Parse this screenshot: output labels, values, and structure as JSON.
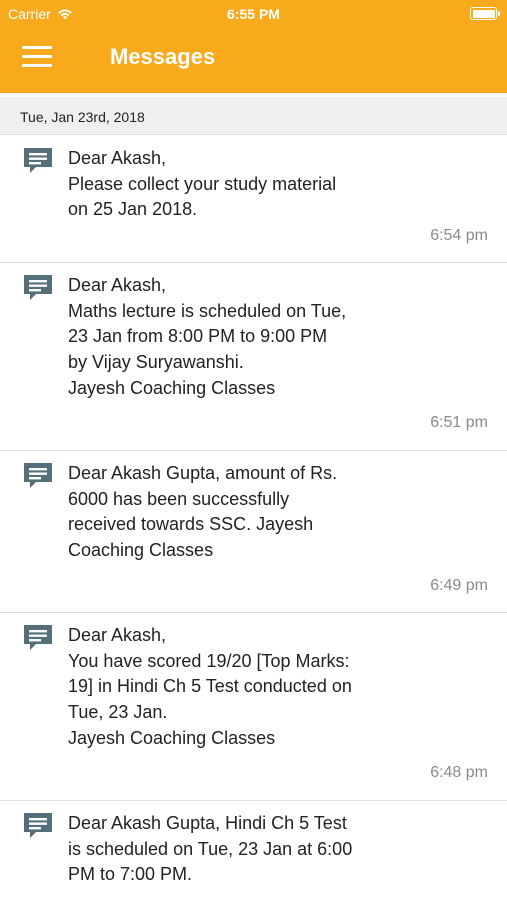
{
  "status_bar": {
    "carrier": "Carrier",
    "time": "6:55 PM",
    "battery_level": 1.0
  },
  "header": {
    "title": "Messages"
  },
  "date_section": "Tue, Jan 23rd, 2018",
  "messages": [
    {
      "text": "Dear Akash,\nPlease collect your study material\non 25 Jan 2018.",
      "time": "6:54 pm"
    },
    {
      "text": "Dear Akash,\nMaths lecture is scheduled on Tue,\n23 Jan from  8:00 PM to  9:00 PM\nby Vijay Suryawanshi.\nJayesh Coaching Classes",
      "time": "6:51 pm"
    },
    {
      "text": "Dear Akash Gupta, amount of Rs.\n6000 has been successfully\nreceived towards SSC. Jayesh\nCoaching Classes",
      "time": "6:49 pm"
    },
    {
      "text": "Dear Akash,\nYou have scored 19/20 [Top Marks:\n19] in Hindi Ch 5 Test conducted on\nTue, 23 Jan.\nJayesh Coaching Classes",
      "time": "6:48 pm"
    },
    {
      "text": "Dear Akash Gupta, Hindi Ch 5 Test\nis scheduled on Tue, 23 Jan at  6:00\nPM to  7:00 PM.",
      "time": ""
    }
  ],
  "colors": {
    "accent": "#f7aa1c",
    "icon": "#546e7a"
  }
}
